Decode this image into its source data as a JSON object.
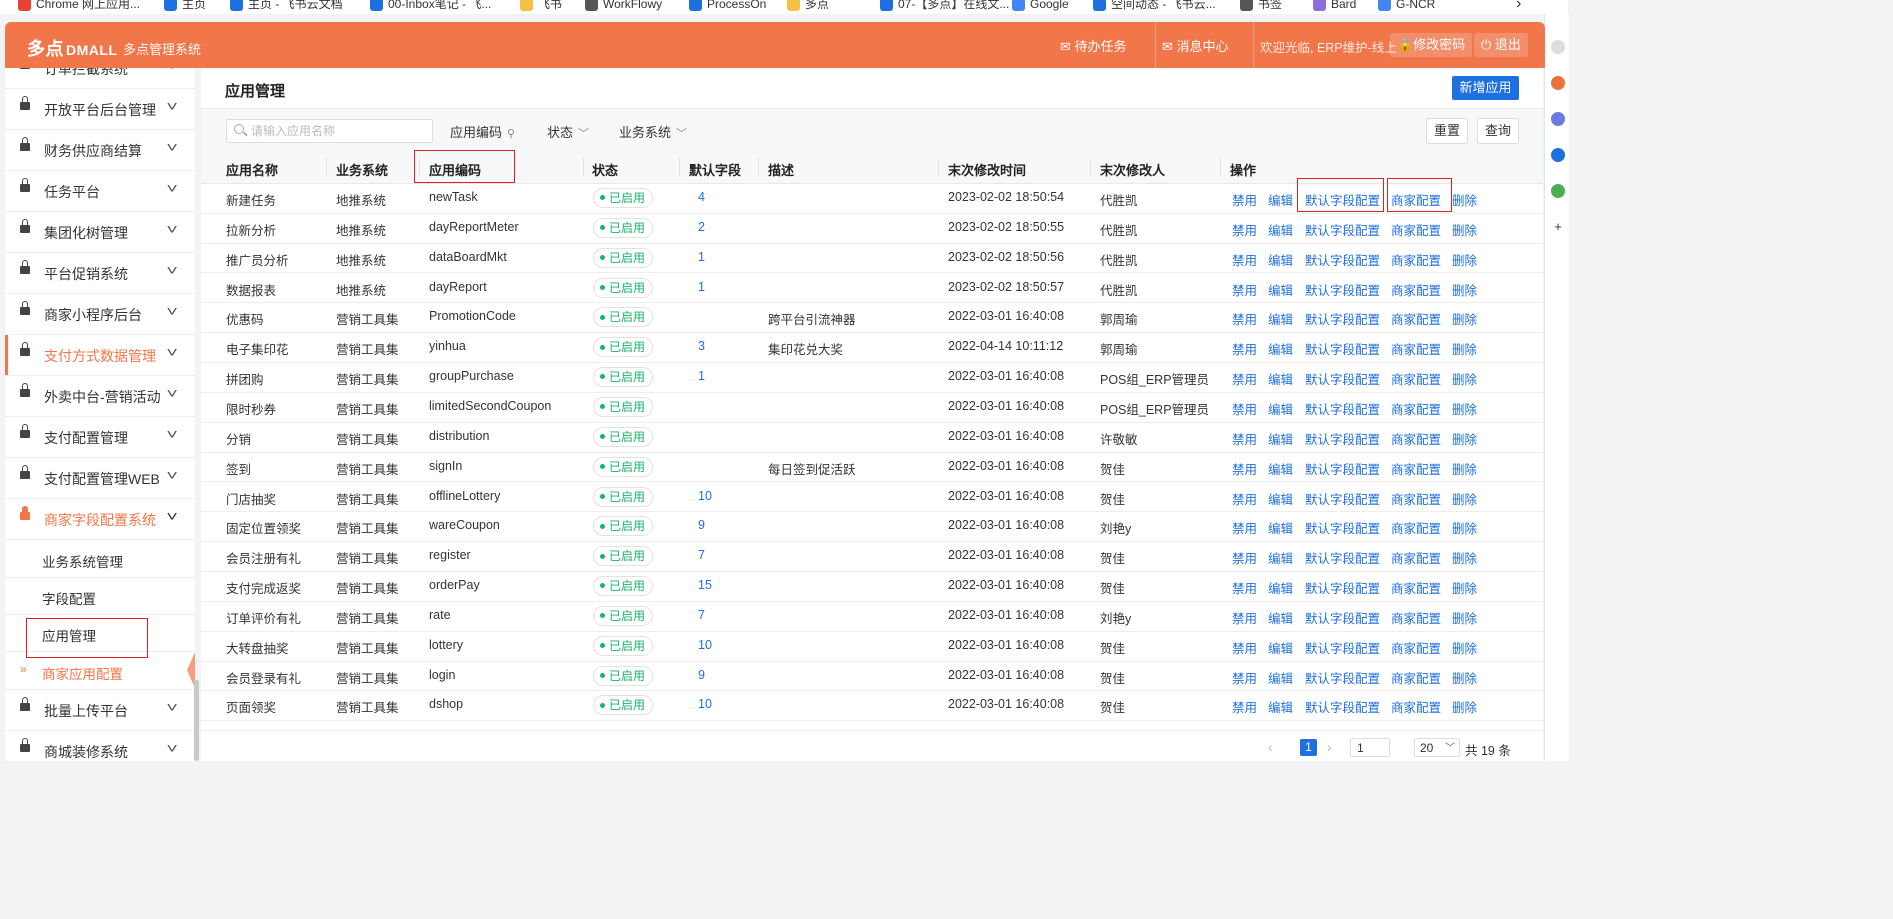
{
  "bookmarks": [
    {
      "label": "Chrome 网上应用...",
      "color": "#e94235"
    },
    {
      "label": "主页",
      "color": "#1e6fe0"
    },
    {
      "label": "主页 - 飞书云文档",
      "color": "#1e6fe0"
    },
    {
      "label": "00-Inbox笔记 - 飞...",
      "color": "#1e6fe0"
    },
    {
      "label": "飞书",
      "color": "#f3c144"
    },
    {
      "label": "WorkFlowy",
      "color": "#555555"
    },
    {
      "label": "ProcessOn",
      "color": "#1e6fe0"
    },
    {
      "label": "多点",
      "color": "#f3c144"
    },
    {
      "label": "07-【多点】在线文...",
      "color": "#1e6fe0"
    },
    {
      "label": "Google",
      "color": "#4285f4"
    },
    {
      "label": "空间动态 - 飞书云...",
      "color": "#1e6fe0"
    },
    {
      "label": "书签",
      "color": "#555555"
    },
    {
      "label": "Bard",
      "color": "#8e6cdf"
    },
    {
      "label": "G-NCR",
      "color": "#4285f4"
    }
  ],
  "header": {
    "logo": "多点",
    "logo_suffix": "DMALL",
    "system_title": "多点管理系统",
    "todo": "待办任务",
    "messages": "消息中心",
    "welcome": "欢迎光临, ERP维护-线上",
    "change_password": "修改密码",
    "logout": "退出",
    "accent_color": "#f1764a"
  },
  "sidebar": {
    "items": [
      {
        "label": "订单拦截系统"
      },
      {
        "label": "开放平台后台管理"
      },
      {
        "label": "财务供应商结算"
      },
      {
        "label": "任务平台"
      },
      {
        "label": "集团化树管理"
      },
      {
        "label": "平台促销系统"
      },
      {
        "label": "商家小程序后台"
      },
      {
        "label": "支付方式数据管理"
      },
      {
        "label": "外卖中台-营销活动"
      },
      {
        "label": "支付配置管理"
      },
      {
        "label": "支付配置管理WEB"
      },
      {
        "label": "商家字段配置系统"
      }
    ],
    "sub_items": [
      {
        "label": "业务系统管理"
      },
      {
        "label": "字段配置"
      },
      {
        "label": "应用管理"
      },
      {
        "label": "商家应用配置"
      }
    ],
    "bottom_items": [
      {
        "label": "批量上传平台"
      },
      {
        "label": "商城装修系统"
      }
    ]
  },
  "main": {
    "title": "应用管理",
    "add_button": "新增应用",
    "search_placeholder": "请输入应用名称",
    "filter_code": "应用编码",
    "filter_status": "状态",
    "filter_system": "业务系统",
    "reset": "重置",
    "query": "查询"
  },
  "table": {
    "columns": [
      "应用名称",
      "业务系统",
      "应用编码",
      "状态",
      "默认字段",
      "描述",
      "末次修改时间",
      "末次修改人",
      "操作"
    ],
    "actions": [
      "禁用",
      "编辑",
      "默认字段配置",
      "商家配置",
      "删除"
    ],
    "rows": [
      {
        "name": "新建任务",
        "system": "地推系统",
        "code": "newTask",
        "status": "已启用",
        "fields": "4",
        "desc": "",
        "time": "2023-02-02 18:50:54",
        "user": "代胜凯"
      },
      {
        "name": "拉新分析",
        "system": "地推系统",
        "code": "dayReportMeter",
        "status": "已启用",
        "fields": "2",
        "desc": "",
        "time": "2023-02-02 18:50:55",
        "user": "代胜凯"
      },
      {
        "name": "推广员分析",
        "system": "地推系统",
        "code": "dataBoardMkt",
        "status": "已启用",
        "fields": "1",
        "desc": "",
        "time": "2023-02-02 18:50:56",
        "user": "代胜凯"
      },
      {
        "name": "数据报表",
        "system": "地推系统",
        "code": "dayReport",
        "status": "已启用",
        "fields": "1",
        "desc": "",
        "time": "2023-02-02 18:50:57",
        "user": "代胜凯"
      },
      {
        "name": "优惠码",
        "system": "营销工具集",
        "code": "PromotionCode",
        "status": "已启用",
        "fields": "",
        "desc": "跨平台引流神器",
        "time": "2022-03-01 16:40:08",
        "user": "郭周瑜"
      },
      {
        "name": "电子集印花",
        "system": "营销工具集",
        "code": "yinhua",
        "status": "已启用",
        "fields": "3",
        "desc": "集印花兑大奖",
        "time": "2022-04-14 10:11:12",
        "user": "郭周瑜"
      },
      {
        "name": "拼团购",
        "system": "营销工具集",
        "code": "groupPurchase",
        "status": "已启用",
        "fields": "1",
        "desc": "",
        "time": "2022-03-01 16:40:08",
        "user": "POS组_ERP管理员"
      },
      {
        "name": "限时秒券",
        "system": "营销工具集",
        "code": "limitedSecondCoupon",
        "status": "已启用",
        "fields": "",
        "desc": "",
        "time": "2022-03-01 16:40:08",
        "user": "POS组_ERP管理员"
      },
      {
        "name": "分销",
        "system": "营销工具集",
        "code": "distribution",
        "status": "已启用",
        "fields": "",
        "desc": "",
        "time": "2022-03-01 16:40:08",
        "user": "许敬敏"
      },
      {
        "name": "签到",
        "system": "营销工具集",
        "code": "signIn",
        "status": "已启用",
        "fields": "",
        "desc": "每日签到促活跃",
        "time": "2022-03-01 16:40:08",
        "user": "贺佳"
      },
      {
        "name": "门店抽奖",
        "system": "营销工具集",
        "code": "offlineLottery",
        "status": "已启用",
        "fields": "10",
        "desc": "",
        "time": "2022-03-01 16:40:08",
        "user": "贺佳"
      },
      {
        "name": "固定位置领奖",
        "system": "营销工具集",
        "code": "wareCoupon",
        "status": "已启用",
        "fields": "9",
        "desc": "",
        "time": "2022-03-01 16:40:08",
        "user": "刘艳y"
      },
      {
        "name": "会员注册有礼",
        "system": "营销工具集",
        "code": "register",
        "status": "已启用",
        "fields": "7",
        "desc": "",
        "time": "2022-03-01 16:40:08",
        "user": "贺佳"
      },
      {
        "name": "支付完成返奖",
        "system": "营销工具集",
        "code": "orderPay",
        "status": "已启用",
        "fields": "15",
        "desc": "",
        "time": "2022-03-01 16:40:08",
        "user": "贺佳"
      },
      {
        "name": "订单评价有礼",
        "system": "营销工具集",
        "code": "rate",
        "status": "已启用",
        "fields": "7",
        "desc": "",
        "time": "2022-03-01 16:40:08",
        "user": "刘艳y"
      },
      {
        "name": "大转盘抽奖",
        "system": "营销工具集",
        "code": "lottery",
        "status": "已启用",
        "fields": "10",
        "desc": "",
        "time": "2022-03-01 16:40:08",
        "user": "贺佳"
      },
      {
        "name": "会员登录有礼",
        "system": "营销工具集",
        "code": "login",
        "status": "已启用",
        "fields": "9",
        "desc": "",
        "time": "2022-03-01 16:40:08",
        "user": "贺佳"
      },
      {
        "name": "页面领奖",
        "system": "营销工具集",
        "code": "dshop",
        "status": "已启用",
        "fields": "10",
        "desc": "",
        "time": "2022-03-01 16:40:08",
        "user": "贺佳"
      }
    ]
  },
  "pagination": {
    "current": "1",
    "jump_value": "1",
    "page_size": "20",
    "total": "共 19 条"
  },
  "colors": {
    "primary": "#1e6fe0",
    "status_green": "#19b36a",
    "highlight_red": "#e02020"
  }
}
